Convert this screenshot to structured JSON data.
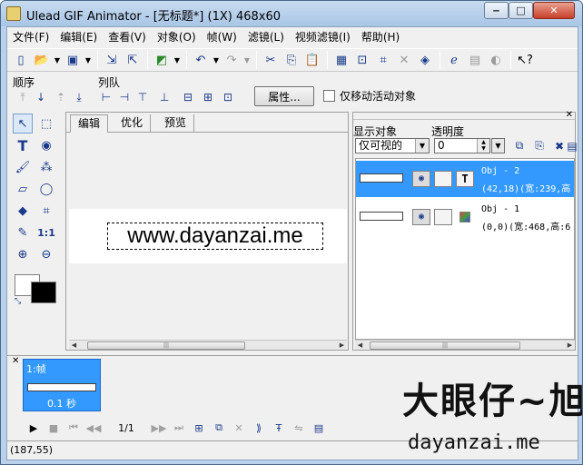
{
  "window": {
    "title": "Ulead GIF Animator - [无标题*] (1X) 468x60"
  },
  "menu": [
    "文件(F)",
    "编辑(E)",
    "查看(V)",
    "对象(O)",
    "帧(W)",
    "滤镜(L)",
    "视频滤镜(I)",
    "帮助(H)"
  ],
  "toolbar": {
    "icons": [
      "new-icon",
      "open-icon",
      "save-icon",
      "import-icon",
      "export-icon",
      "color-picker-icon",
      "undo-icon",
      "redo-icon",
      "cut-icon",
      "copy-icon",
      "paste-icon",
      "frame-props-icon",
      "resize-icon",
      "crop-icon",
      "rotate-icon",
      "optimize-icon",
      "ie-preview-icon",
      "gray-icon",
      "help-icon"
    ]
  },
  "orderbar": {
    "order_label": "顺序",
    "queue_label": "列队",
    "properties_label": "属性...",
    "only_active_label": "仅移动活动对象"
  },
  "editor": {
    "tabs": [
      "编辑",
      "优化",
      "预览"
    ],
    "banner_text": "www.dayanzai.me"
  },
  "objects": {
    "show_label": "显示对象",
    "opacity_label": "透明度",
    "show_value": "仅可视的",
    "opacity_value": "0",
    "items": [
      {
        "name": "Obj - 2",
        "info": "(42,18)(宽:239,高"
      },
      {
        "name": "Obj - 1",
        "info": "(0,0)(宽:468,高:6"
      }
    ]
  },
  "frames": {
    "items": [
      {
        "label": "1:帧",
        "delay": "0.1 秒"
      }
    ],
    "count": "1/1"
  },
  "status": {
    "coords": "(187,55)"
  },
  "watermark": {
    "big": "大眼仔~旭",
    "small": "dayanzai.me"
  }
}
